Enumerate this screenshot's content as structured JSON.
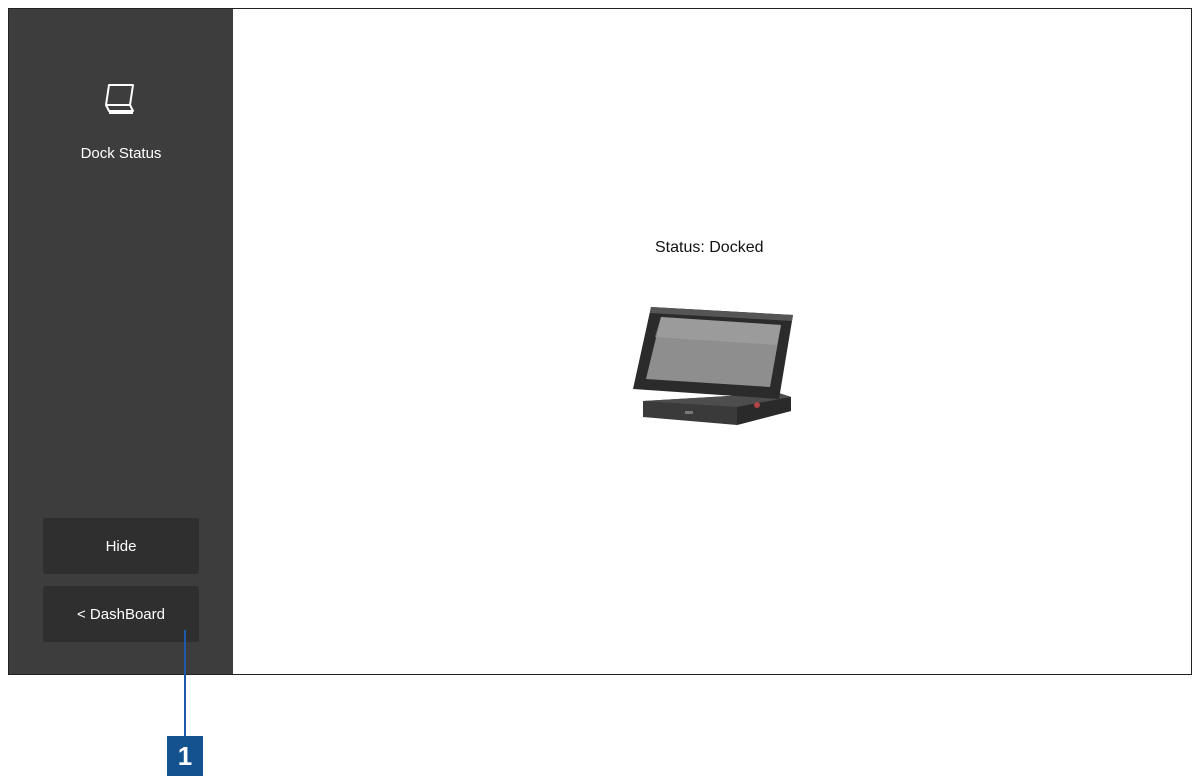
{
  "sidebar": {
    "dock_status_label": "Dock Status",
    "hide_label": "Hide",
    "dashboard_label": "< DashBoard"
  },
  "main": {
    "status_text": "Status: Docked"
  },
  "callout": {
    "number": "1"
  },
  "colors": {
    "sidebar_bg": "#3d3d3d",
    "button_bg": "#2f2f2f",
    "callout_blue": "#14528f"
  },
  "icons": {
    "dock_status": "tablet-dock-icon"
  }
}
